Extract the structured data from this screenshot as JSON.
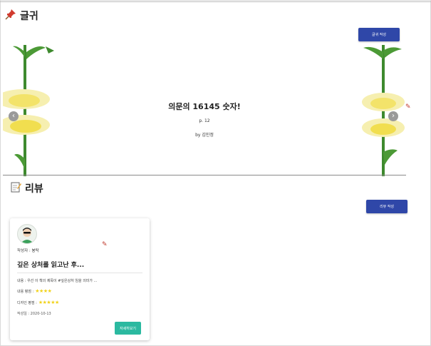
{
  "quote_section": {
    "title": "글귀",
    "write_button": "글귀 작성",
    "slide": {
      "title": "의문의 16145 숫자!",
      "page": "p. 12",
      "author": "by 김민정"
    }
  },
  "review_section": {
    "title": "리뷰",
    "write_button": "리뷰 작성",
    "cards": [
      {
        "writer": "작성자 : 붕탁",
        "title": "깊은 상처를 읽고난 후...",
        "content": "내용 : 우선 이 책의 제목이 #깊은상처 임을 의미가 ...",
        "rating1_label": "내용 평점 :",
        "rating1_value": 4,
        "rating2_label": "디자인 평점 :",
        "rating2_value": 5,
        "date": "작성일 : 2020-10-13",
        "detail_button": "자세히보기"
      }
    ]
  },
  "colors": {
    "primary_button": "#2f47a8",
    "detail_button": "#2bb9a0",
    "star": "#f1d21a"
  },
  "icons": [
    "pushpin-icon",
    "memo-icon",
    "chevron-left-icon",
    "chevron-right-icon",
    "star-icon",
    "avatar-icon"
  ]
}
